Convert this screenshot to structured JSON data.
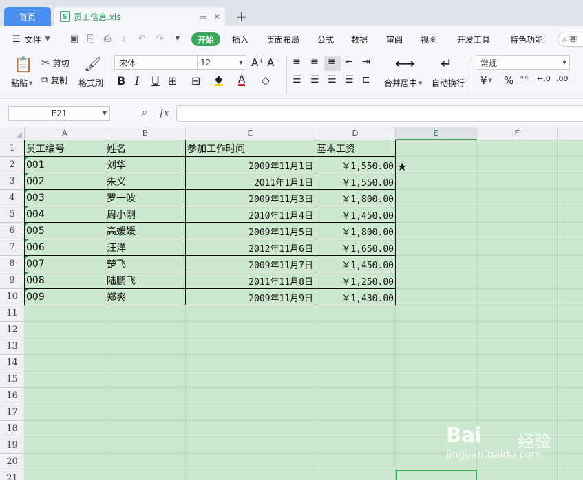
{
  "tabs": {
    "home": "首页",
    "file": "员工信息.xls"
  },
  "menu": {
    "file": "文件",
    "items": [
      "开始",
      "插入",
      "页面布局",
      "公式",
      "数据",
      "审阅",
      "视图",
      "开发工具",
      "特色功能"
    ],
    "search": "查"
  },
  "ribbon": {
    "paste": "粘贴",
    "cut": "剪切",
    "copy": "复制",
    "format_painter": "格式刷",
    "font_name": "宋体",
    "font_size": "12",
    "merge_center": "合并居中",
    "wrap_text": "自动换行",
    "number_format": "常规",
    "currency_symbol": "¥",
    "percent_symbol": "%"
  },
  "formula_bar": {
    "name_box": "E21",
    "fx": "fx",
    "formula": ""
  },
  "sheet": {
    "columns": [
      "A",
      "B",
      "C",
      "D",
      "E",
      "F"
    ],
    "selected_column": "E",
    "rows": [
      "1",
      "2",
      "3",
      "4",
      "5",
      "6",
      "7",
      "8",
      "9",
      "10",
      "11",
      "12",
      "13",
      "14",
      "15",
      "16",
      "17",
      "18",
      "19",
      "20",
      "21"
    ],
    "headers": [
      "员工编号",
      "姓名",
      "参加工作时间",
      "基本工资"
    ],
    "records": [
      [
        "001",
        "刘华",
        "2009年11月1日",
        "￥1,550.00"
      ],
      [
        "002",
        "朱义",
        "2011年1月1日",
        "￥1,550.00"
      ],
      [
        "003",
        "罗一波",
        "2009年11月3日",
        "￥1,800.00"
      ],
      [
        "004",
        "周小刚",
        "2010年11月4日",
        "￥1,450.00"
      ],
      [
        "005",
        "高媛媛",
        "2009年11月5日",
        "￥1,800.00"
      ],
      [
        "006",
        "汪洋",
        "2012年11月6日",
        "￥1,650.00"
      ],
      [
        "007",
        "楚飞",
        "2009年11月7日",
        "￥1,450.00"
      ],
      [
        "008",
        "陆鹏飞",
        "2011年11月8日",
        "￥1,250.00"
      ],
      [
        "009",
        "郑爽",
        "2009年11月9日",
        "￥1,430.00"
      ]
    ],
    "marker": "★"
  },
  "watermark": {
    "logo": "Bai",
    "cn": "经验",
    "url": "jingyan.baidu.com"
  },
  "colors": {
    "accent": "#3aa85b",
    "home_tab": "#4a8ff0",
    "sheet_bg": "#cce8cf"
  }
}
